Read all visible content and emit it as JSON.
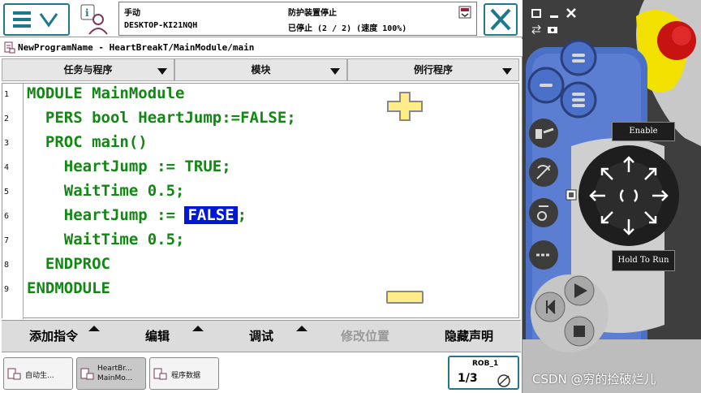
{
  "status": {
    "mode": "手动",
    "controller": "DESKTOP-KI21NQH",
    "state": "防护装置停止",
    "detail": "已停止 (2 / 2) (速度 100%)"
  },
  "path": "NewProgramName - HeartBreakT/MainModule/main",
  "tabs": [
    "任务与程序",
    "模块",
    "例行程序"
  ],
  "line_numbers": [
    "1",
    "2",
    "3",
    "4",
    "5",
    "6",
    "7",
    "8",
    "9"
  ],
  "code": {
    "l1": "MODULE MainModule",
    "l2": "  PERS bool HeartJump:=FALSE;",
    "l3": "  PROC main()",
    "l4": "    HeartJump := TRUE;",
    "l5": "    WaitTime 0.5;",
    "l6_pre": "    HeartJump := ",
    "l6_sel": "FALSE",
    "l6_post": ";",
    "l7": "    WaitTime 0.5;",
    "l8": "  ENDPROC",
    "l9": "ENDMODULE"
  },
  "commands": [
    "添加指令",
    "编辑",
    "调试",
    "修改位置",
    "隐藏声明"
  ],
  "tasks": [
    {
      "label": "自动生..."
    },
    {
      "label1": "HeartBr...",
      "label2": "MainMo..."
    },
    {
      "label": "程序数据"
    }
  ],
  "rob": {
    "name": "ROB_1",
    "speed": "1/3"
  },
  "pendant": {
    "enable": "Enable",
    "hold": "Hold To Run"
  },
  "watermark": "CSDN @穷的捡破烂儿",
  "colors": {
    "accent": "#1e7a8a",
    "code": "#118811",
    "selection": "#0018d0",
    "pendant_blue": "#4a70c8",
    "estop": "#d41515"
  }
}
